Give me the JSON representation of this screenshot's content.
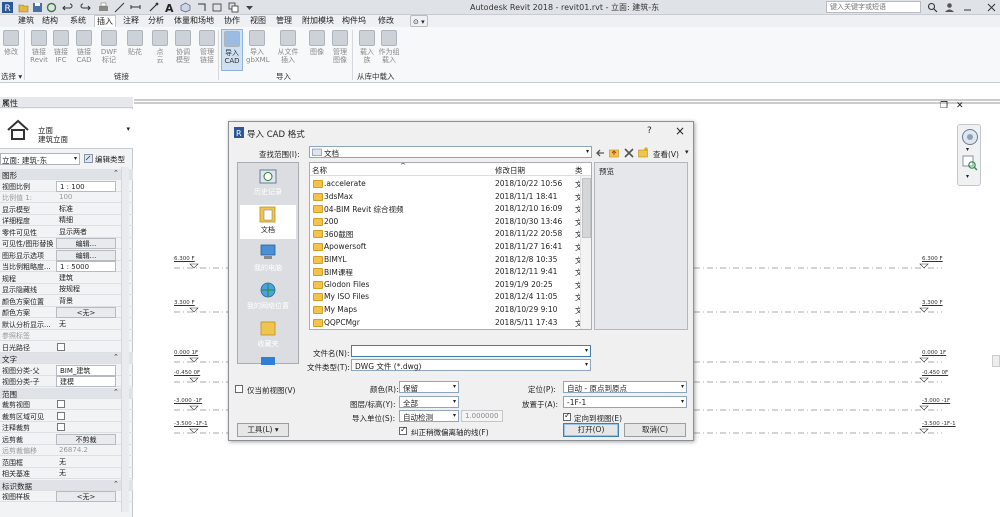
{
  "window": {
    "title": "Autodesk Revit 2018 -    revit01.rvt - 立面: 建筑-东",
    "search_placeholder": "键入关键字或短语"
  },
  "menu_tabs": [
    "建筑",
    "结构",
    "系统",
    "插入",
    "注释",
    "分析",
    "体量和场地",
    "协作",
    "视图",
    "管理",
    "附加模块",
    "构件坞",
    "修改"
  ],
  "ribbon": {
    "buttons": [
      {
        "label": "修改"
      },
      {
        "label": "链接\nRevit"
      },
      {
        "label": "链接\nIFC"
      },
      {
        "label": "链接\nCAD"
      },
      {
        "label": "DWF\n标记"
      },
      {
        "label": "贴花"
      },
      {
        "label": "点\n云"
      },
      {
        "label": "协调\n模型"
      },
      {
        "label": "管理\n链接"
      },
      {
        "label": "导入\nCAD"
      },
      {
        "label": "导入\ngbXML"
      },
      {
        "label": "从文件\n插入"
      },
      {
        "label": "图像"
      },
      {
        "label": "管理\n图像"
      },
      {
        "label": "载入\n族"
      },
      {
        "label": "作为组\n载入"
      }
    ],
    "groups": {
      "select": "选择 ▾",
      "link": "链接",
      "import": "导入",
      "library": "从库中载入"
    }
  },
  "properties": {
    "title": "属性",
    "type_line1": "立面",
    "type_line2": "建筑立面",
    "filter": "立面: 建筑-东",
    "edit_type": "编辑类型",
    "rows": [
      {
        "label": "图形",
        "value": "",
        "kind": "cat"
      },
      {
        "label": "视图比例",
        "value": "1 : 100",
        "kind": "box"
      },
      {
        "label": "比例值 1:",
        "value": "100",
        "kind": "dim"
      },
      {
        "label": "显示模型",
        "value": "标准",
        "kind": "text"
      },
      {
        "label": "详细程度",
        "value": "精细",
        "kind": "text"
      },
      {
        "label": "零件可见性",
        "value": "显示两者",
        "kind": "text"
      },
      {
        "label": "可见性/图形替换",
        "value": "编辑...",
        "kind": "btn"
      },
      {
        "label": "图形显示选项",
        "value": "编辑...",
        "kind": "btn"
      },
      {
        "label": "当比例粗略度...",
        "value": "1 : 5000",
        "kind": "box"
      },
      {
        "label": "规程",
        "value": "建筑",
        "kind": "text"
      },
      {
        "label": "显示隐藏线",
        "value": "按规程",
        "kind": "text"
      },
      {
        "label": "颜色方案位置",
        "value": "背景",
        "kind": "text"
      },
      {
        "label": "颜色方案",
        "value": "<无>",
        "kind": "btn"
      },
      {
        "label": "默认分析显示...",
        "value": "无",
        "kind": "text"
      },
      {
        "label": "参照标签",
        "value": "",
        "kind": "dim"
      },
      {
        "label": "日光路径",
        "value": "",
        "kind": "chk"
      },
      {
        "label": "文字",
        "value": "",
        "kind": "cat"
      },
      {
        "label": "视图分类-父",
        "value": "BIM_建筑",
        "kind": "box"
      },
      {
        "label": "视图分类-子",
        "value": "建模",
        "kind": "box"
      },
      {
        "label": "范围",
        "value": "",
        "kind": "cat"
      },
      {
        "label": "裁剪视图",
        "value": "",
        "kind": "chk"
      },
      {
        "label": "裁剪区域可见",
        "value": "",
        "kind": "chk"
      },
      {
        "label": "注释裁剪",
        "value": "",
        "kind": "chk"
      },
      {
        "label": "远剪裁",
        "value": "不剪裁",
        "kind": "btn"
      },
      {
        "label": "远剪裁偏移",
        "value": "26874.2",
        "kind": "dim"
      },
      {
        "label": "范围框",
        "value": "无",
        "kind": "text"
      },
      {
        "label": "相关基准",
        "value": "无",
        "kind": "text"
      },
      {
        "label": "标识数据",
        "value": "",
        "kind": "cat"
      },
      {
        "label": "视图样板",
        "value": "<无>",
        "kind": "btn"
      }
    ]
  },
  "levels": [
    {
      "left": "6.300 F",
      "right": "6.300 F"
    },
    {
      "left": "3.300 F",
      "right": "3.300 F"
    },
    {
      "left": "0.000 1F",
      "right": "0.000 1F"
    },
    {
      "left": "-0.450 0F",
      "right": "-0.450 0F"
    },
    {
      "left": "-3.000 -1F",
      "right": "-3.000 -1F"
    },
    {
      "left": "-3.500 -1F-1",
      "right": "-3.500 -1F-1"
    }
  ],
  "dialog": {
    "title": "导入 CAD 格式",
    "help": "?",
    "close": "×",
    "look_in_label": "查找范围(I):",
    "look_in_value": "文档",
    "views_label": "查看(V)",
    "preview_label": "预览",
    "columns": {
      "name": "名称",
      "date": "修改日期",
      "type": "类"
    },
    "places": [
      "历史记录",
      "文档",
      "我的电脑",
      "我的网络位置",
      "收藏夹",
      ""
    ],
    "files": [
      {
        "name": ".accelerate",
        "date": "2018/10/22 10:56",
        "type": "文"
      },
      {
        "name": "3dsMax",
        "date": "2018/11/1 18:41",
        "type": "文"
      },
      {
        "name": "04-BIM Revit  综合视频",
        "date": "2018/12/10 16:09",
        "type": "文"
      },
      {
        "name": "200",
        "date": "2018/10/30 13:46",
        "type": "文"
      },
      {
        "name": "360截图",
        "date": "2018/11/22 20:58",
        "type": "文"
      },
      {
        "name": "Apowersoft",
        "date": "2018/11/27 16:41",
        "type": "文"
      },
      {
        "name": "BIMYL",
        "date": "2018/12/8 10:35",
        "type": "文"
      },
      {
        "name": "BIM课程",
        "date": "2018/12/11 9:41",
        "type": "文"
      },
      {
        "name": "Glodon Files",
        "date": "2019/1/9 20:25",
        "type": "文"
      },
      {
        "name": "My ISO Files",
        "date": "2018/12/4 11:05",
        "type": "文"
      },
      {
        "name": "My Maps",
        "date": "2018/10/29 9:10",
        "type": "文"
      },
      {
        "name": "QQPCMgr",
        "date": "2018/5/11 17:43",
        "type": "文"
      }
    ],
    "filename_label": "文件名(N):",
    "filename_value": "",
    "filetype_label": "文件类型(T):",
    "filetype_value": "DWG 文件 (*.dwg)",
    "current_view_only": "仅当前视图(V)",
    "colors_label": "颜色(R):",
    "colors_value": "保留",
    "layers_label": "图层/标高(Y):",
    "layers_value": "全部",
    "units_label": "导入单位(S):",
    "units_value": "自动检测",
    "units_scale": "1.000000",
    "correct_lines": "纠正稍微偏离轴的线(F)",
    "position_label": "定位(P):",
    "position_value": "自动 - 原点到原点",
    "place_at_label": "放置于(A):",
    "place_at_value": "-1F-1",
    "orient_to_view": "定向到视图(E)",
    "tools_label": "工具(L)",
    "open_label": "打开(O)",
    "cancel_label": "取消(C)"
  }
}
